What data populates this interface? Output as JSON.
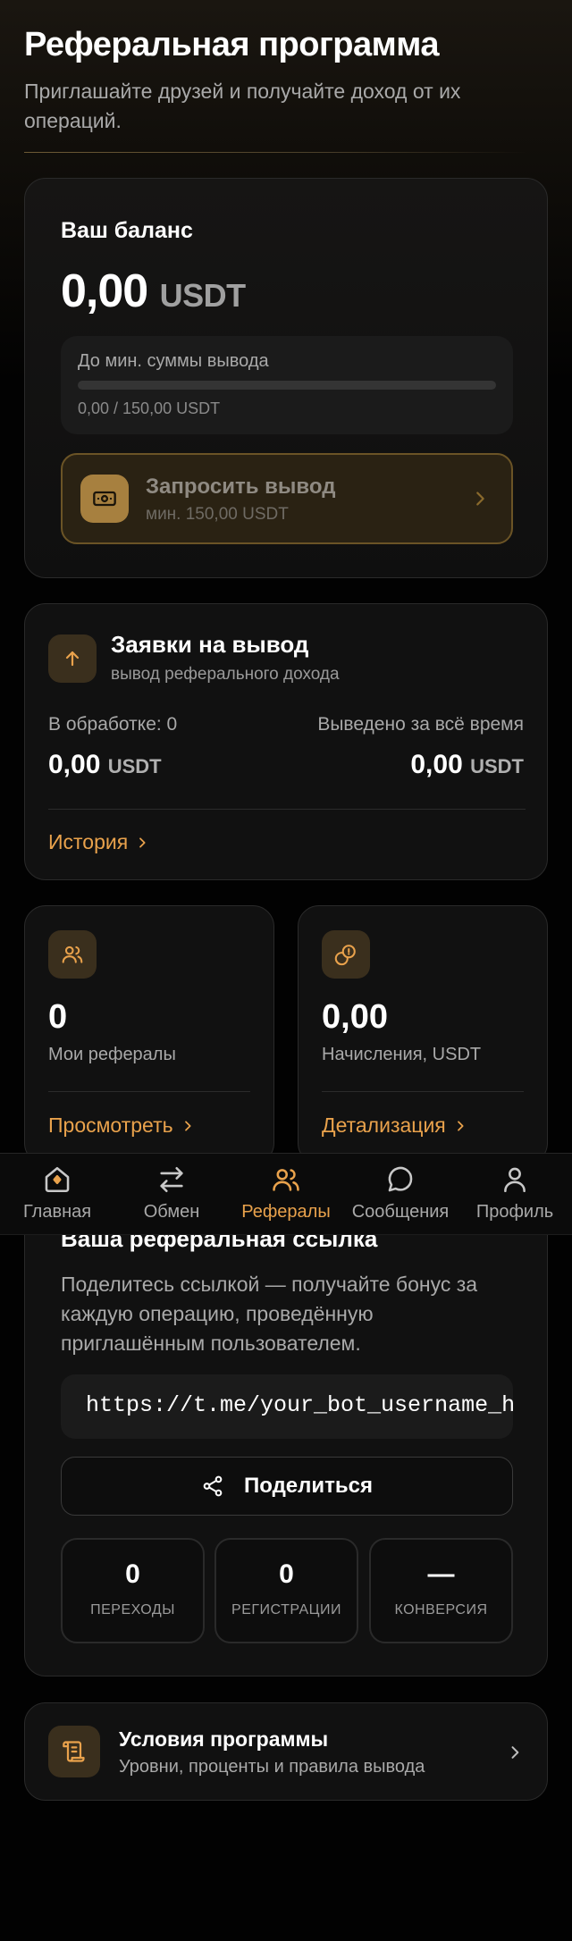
{
  "header": {
    "title": "Реферальная программа",
    "subtitle": "Приглашайте друзей и получайте доход от их операций."
  },
  "balance": {
    "label": "Ваш баланс",
    "amount": "0,00",
    "currency": "USDT",
    "progress_label": "До мин. суммы вывода",
    "progress_value": "0,00 / 150,00 USDT",
    "progress_fraction": 0,
    "withdraw_title": "Запросить вывод",
    "withdraw_sub": "мин. 150,00 USDT"
  },
  "requests": {
    "title": "Заявки на вывод",
    "subtitle": "вывод реферального дохода",
    "in_process": "В обработке: 0",
    "total_label": "Выведено за всё время",
    "in_process_amount": "0,00",
    "total_amount": "0,00",
    "currency": "USDT",
    "history_link": "История"
  },
  "stats": {
    "referrals_value": "0",
    "referrals_label": "Мои рефералы",
    "referrals_link": "Просмотреть",
    "accruals_value": "0,00",
    "accruals_label": "Начисления, USDT",
    "accruals_link": "Детализация"
  },
  "referral": {
    "title": "Ваша реферальная ссылка",
    "description": "Поделитесь ссылкой — получайте бонус за каждую операцию, проведённую приглашённым пользователем.",
    "link": "https://t.me/your_bot_username_here",
    "share_label": "Поделиться",
    "metrics": [
      {
        "value": "0",
        "label": "ПЕРЕХОДЫ"
      },
      {
        "value": "0",
        "label": "РЕГИСТРАЦИИ"
      },
      {
        "value": "—",
        "label": "КОНВЕРСИЯ"
      }
    ]
  },
  "terms": {
    "title": "Условия программы",
    "subtitle": "Уровни, проценты и правила вывода"
  },
  "nav": {
    "items": [
      {
        "label": "Главная",
        "icon": "home-icon"
      },
      {
        "label": "Обмен",
        "icon": "exchange-icon"
      },
      {
        "label": "Рефералы",
        "icon": "users-icon"
      },
      {
        "label": "Сообщения",
        "icon": "message-icon"
      },
      {
        "label": "Профиль",
        "icon": "profile-icon"
      }
    ],
    "active": "Рефералы"
  },
  "colors": {
    "accent": "#e9a24c",
    "background": "#020202",
    "card": "#111111"
  }
}
